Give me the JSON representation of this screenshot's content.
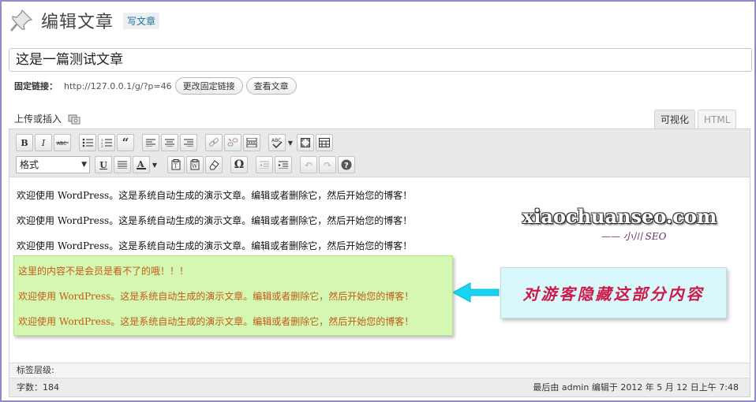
{
  "header": {
    "title": "编辑文章",
    "write_button": "写文章"
  },
  "post": {
    "title": "这是一篇测试文章"
  },
  "permalink": {
    "label": "固定链接：",
    "url": "http://127.0.0.1/g/?p=46",
    "change_button": "更改固定链接",
    "view_button": "查看文章"
  },
  "upload": {
    "label": "上传或插入"
  },
  "tabs": {
    "visual": "可视化",
    "html": "HTML"
  },
  "toolbar": {
    "format_select": "格式"
  },
  "content": {
    "paragraphs": [
      "欢迎使用 WordPress。这是系统自动生成的演示文章。编辑或者删除它，然后开始您的博客！",
      "欢迎使用 WordPress。这是系统自动生成的演示文章。编辑或者删除它，然后开始您的博客！",
      "欢迎使用 WordPress。这是系统自动生成的演示文章。编辑或者删除它，然后开始您的博客！"
    ],
    "hidden": [
      "这里的内容不是会员是看不了的哦！！！",
      "欢迎使用 WordPress。这是系统自动生成的演示文章。编辑或者删除它，然后开始您的博客！",
      "欢迎使用 WordPress。这是系统自动生成的演示文章。编辑或者删除它，然后开始您的博客！"
    ]
  },
  "annotation": {
    "callout": "对游客隐藏这部分内容",
    "watermark": "xiaochuanseo.com",
    "watermark_sub": "—— 小川 SEO"
  },
  "footer": {
    "path_label": "标签层级:",
    "word_count": "字数：184",
    "last_edited": "最后由 admin 编辑于 2012 年 5 月 12 日上午 7:48"
  },
  "colors": {
    "accent": "#21759b",
    "hidden_bg": "#d4f7b1",
    "hidden_text": "#c45a17",
    "callout_bg": "#d8f8fb",
    "callout_text": "#cc1a4a",
    "arrow": "#19d3f2"
  }
}
